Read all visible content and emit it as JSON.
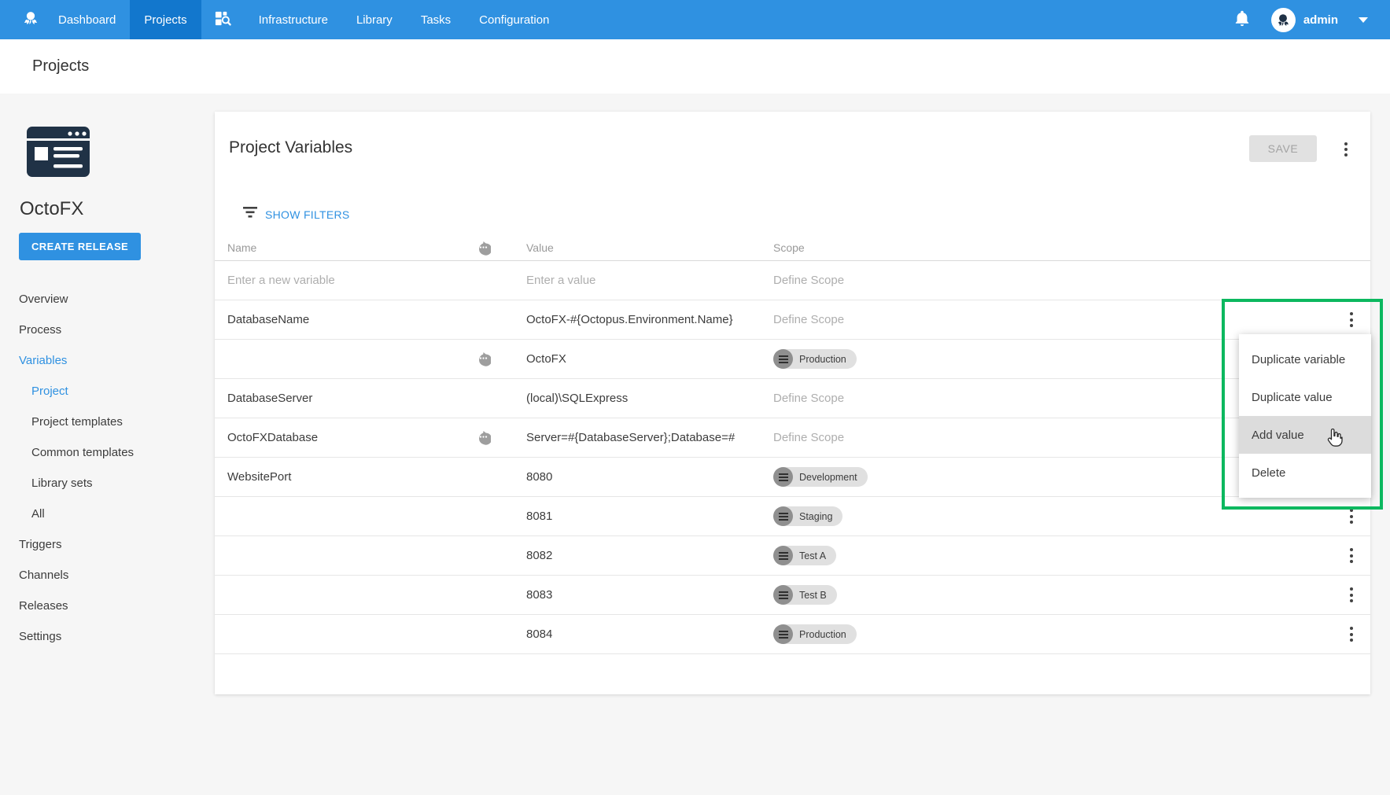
{
  "nav": {
    "items": [
      {
        "label": "Dashboard"
      },
      {
        "label": "Projects"
      },
      {
        "label": "Infrastructure"
      },
      {
        "label": "Library"
      },
      {
        "label": "Tasks"
      },
      {
        "label": "Configuration"
      }
    ],
    "user": {
      "name": "admin"
    }
  },
  "page": {
    "title": "Projects"
  },
  "project": {
    "name": "OctoFX",
    "create_release_label": "CREATE RELEASE",
    "menu": [
      {
        "label": "Overview"
      },
      {
        "label": "Process"
      },
      {
        "label": "Variables"
      },
      {
        "label": "Project"
      },
      {
        "label": "Project templates"
      },
      {
        "label": "Common templates"
      },
      {
        "label": "Library sets"
      },
      {
        "label": "All"
      },
      {
        "label": "Triggers"
      },
      {
        "label": "Channels"
      },
      {
        "label": "Releases"
      },
      {
        "label": "Settings"
      }
    ]
  },
  "panel": {
    "title": "Project Variables",
    "save_label": "SAVE",
    "show_filters_label": "SHOW FILTERS",
    "columns": {
      "name": "Name",
      "value": "Value",
      "scope": "Scope"
    }
  },
  "table": {
    "new_row": {
      "name_placeholder": "Enter a new variable",
      "value_placeholder": "Enter a value",
      "scope_placeholder": "Define Scope"
    },
    "rows": [
      {
        "name": "DatabaseName",
        "value": "OctoFX-#{Octopus.Environment.Name}",
        "scope": "Define Scope"
      },
      {
        "name": "",
        "value": "OctoFX",
        "chip": "Production"
      },
      {
        "name": "DatabaseServer",
        "value": "(local)\\SQLExpress",
        "scope": "Define Scope"
      },
      {
        "name": "OctoFXDatabase",
        "value": "Server=#{DatabaseServer};Database=#",
        "scope": "Define Scope"
      },
      {
        "name": "WebsitePort",
        "value": "8080",
        "chip": "Development"
      },
      {
        "name": "",
        "value": "8081",
        "chip": "Staging"
      },
      {
        "name": "",
        "value": "8082",
        "chip": "Test A"
      },
      {
        "name": "",
        "value": "8083",
        "chip": "Test B"
      },
      {
        "name": "",
        "value": "8084",
        "chip": "Production"
      }
    ]
  },
  "context_menu": {
    "items": [
      {
        "label": "Duplicate variable"
      },
      {
        "label": "Duplicate value"
      },
      {
        "label": "Add value"
      },
      {
        "label": "Delete"
      }
    ]
  },
  "colors": {
    "nav_bg": "#2f91e1",
    "nav_active": "#1277cd",
    "accent_blue": "#2f91e1",
    "annotation_green": "#0cb85f",
    "logo_navy": "#203246",
    "chip_bg": "#e0e0e0"
  }
}
